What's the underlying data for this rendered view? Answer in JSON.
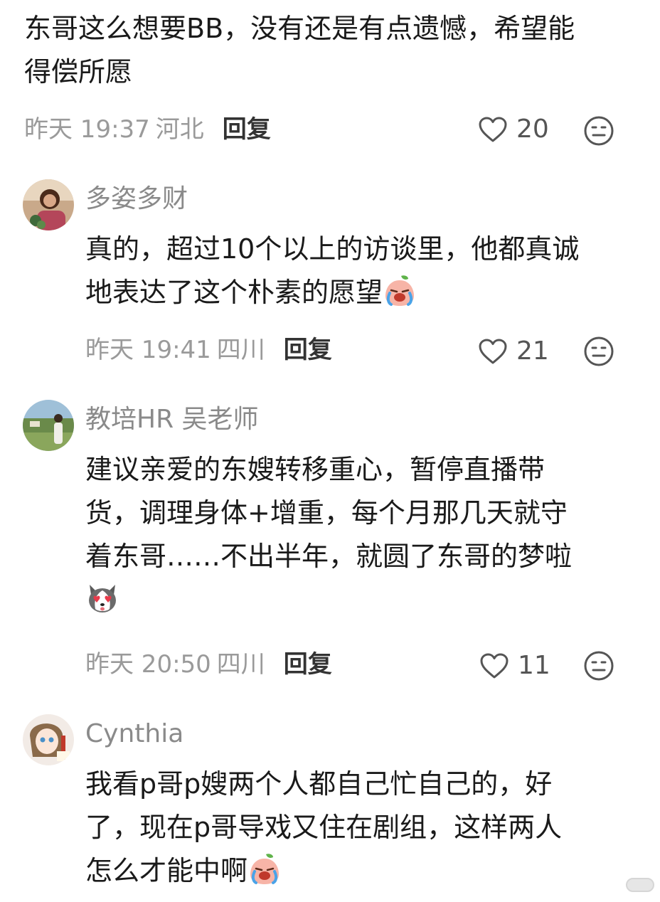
{
  "comments": [
    {
      "lines": [
        "东哥这么想要BB，没有还是有点遗憾，希望能",
        "得偿所愿"
      ],
      "time": "昨天 19:37",
      "location": "河北",
      "reply_label": "回复",
      "likes": "20"
    },
    {
      "username": "多姿多财",
      "lines": [
        "真的，超过10个以上的访谈里，他都真诚",
        "地表达了这个朴素的愿望"
      ],
      "time": "昨天 19:41",
      "location": "四川",
      "reply_label": "回复",
      "likes": "21",
      "emoji": "crying-peach-emoji"
    },
    {
      "username": "教培HR 吴老师",
      "lines": [
        "建议亲爱的东嫂转移重心，暂停直播带",
        "货，调理身体+增重，每个月那几天就守",
        "着东哥……不出半年，就圆了东哥的梦啦"
      ],
      "time": "昨天 20:50",
      "location": "四川",
      "reply_label": "回复",
      "likes": "11",
      "emoji": "husky-love-emoji"
    },
    {
      "username": "Cynthia",
      "lines": [
        "我看p哥p嫂两个人都自己忙自己的，好",
        "了，现在p哥导戏又住在剧组，这样两人",
        "怎么才能中啊"
      ],
      "emoji": "crying-peach-emoji"
    }
  ],
  "colors": {
    "text": "#1a1a1a",
    "muted": "#9a9a9a",
    "username": "#8a8a8a",
    "reply": "#333333"
  }
}
